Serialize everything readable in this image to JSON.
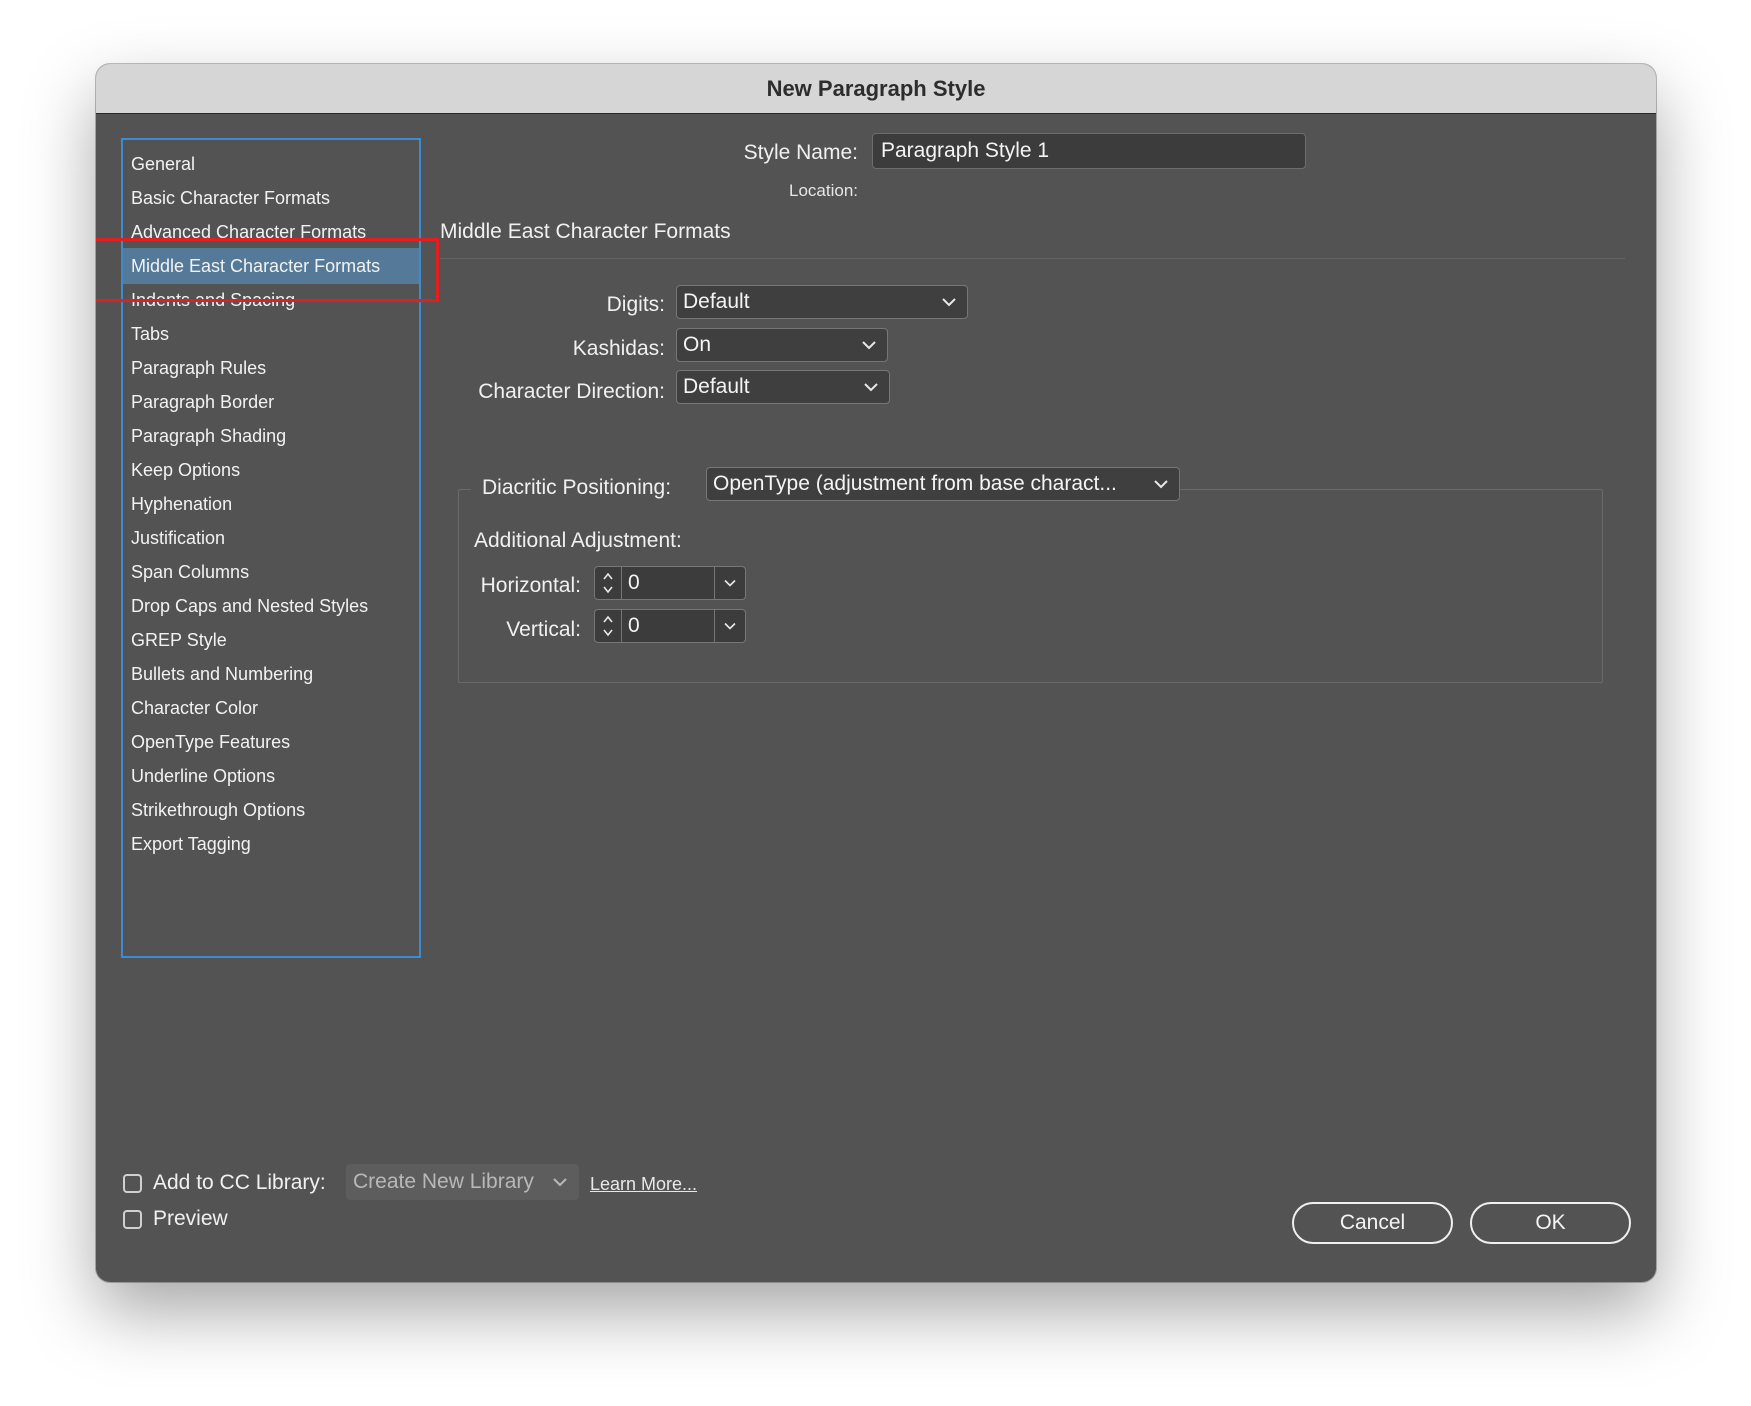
{
  "window": {
    "title": "New Paragraph Style"
  },
  "sidebar": {
    "items": [
      {
        "label": "General"
      },
      {
        "label": "Basic Character Formats"
      },
      {
        "label": "Advanced Character Formats"
      },
      {
        "label": "Middle East Character Formats",
        "selected": true
      },
      {
        "label": "Indents and Spacing"
      },
      {
        "label": "Tabs"
      },
      {
        "label": "Paragraph Rules"
      },
      {
        "label": "Paragraph Border"
      },
      {
        "label": "Paragraph Shading"
      },
      {
        "label": "Keep Options"
      },
      {
        "label": "Hyphenation"
      },
      {
        "label": "Justification"
      },
      {
        "label": "Span Columns"
      },
      {
        "label": "Drop Caps and Nested Styles"
      },
      {
        "label": "GREP Style"
      },
      {
        "label": "Bullets and Numbering"
      },
      {
        "label": "Character Color"
      },
      {
        "label": "OpenType Features"
      },
      {
        "label": "Underline Options"
      },
      {
        "label": "Strikethrough Options"
      },
      {
        "label": "Export Tagging"
      }
    ]
  },
  "header": {
    "style_name_label": "Style Name:",
    "style_name_value": "Paragraph Style 1",
    "location_label": "Location:"
  },
  "section": {
    "title": "Middle East Character Formats",
    "digits_label": "Digits:",
    "digits_value": "Default",
    "kashidas_label": "Kashidas:",
    "kashidas_value": "On",
    "char_direction_label": "Character Direction:",
    "char_direction_value": "Default",
    "diacritic_label": "Diacritic Positioning:",
    "diacritic_value": "OpenType (adjustment from base charact...",
    "additional_label": "Additional Adjustment:",
    "horizontal_label": "Horizontal:",
    "horizontal_value": "0",
    "vertical_label": "Vertical:",
    "vertical_value": "0"
  },
  "footer": {
    "cc_library_label": "Add to CC Library:",
    "cc_library_value": "Create New Library",
    "learn_more": "Learn More...",
    "preview_label": "Preview",
    "cancel_label": "Cancel",
    "ok_label": "OK"
  },
  "icons": {
    "dropdown": "chevron-down-icon",
    "stepper": "stepper-arrows-icon"
  },
  "colors": {
    "dialog_bg": "#535353",
    "titlebar_bg": "#d6d6d6",
    "selection": "#557a99",
    "sidebar_border": "#3d8bd1",
    "annotation_red": "#e02020"
  }
}
